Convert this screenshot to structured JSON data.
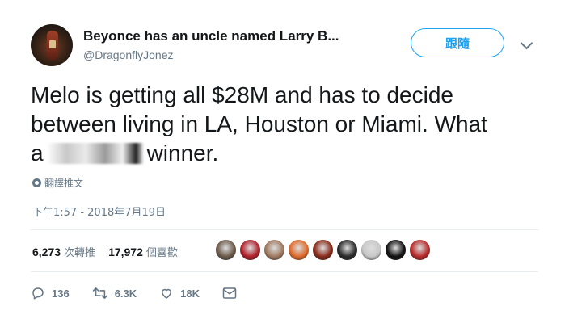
{
  "author": {
    "name": "Beyonce has an uncle named Larry B...",
    "handle": "@DragonflyJonez"
  },
  "follow_label": "跟隨",
  "tweet": {
    "line1": "Melo is getting all $28M and has to decide",
    "line2": "between living in LA, Houston or Miami. What",
    "line3_prefix": "a",
    "line3_suffix": "winner."
  },
  "translate_label": "翻譯推文",
  "timestamp": "下午1:57 - 2018年7月19日",
  "stats": {
    "retweets_count": "6,273",
    "retweets_label": "次轉推",
    "likes_count": "17,972",
    "likes_label": "個喜歡"
  },
  "liker_avatars": [
    {
      "name": "avatar-1",
      "color": "#6b5a4a"
    },
    {
      "name": "avatar-2",
      "color": "#b0202a"
    },
    {
      "name": "avatar-3",
      "color": "#a07a60"
    },
    {
      "name": "avatar-4",
      "color": "#e06a2a"
    },
    {
      "name": "avatar-5",
      "color": "#8a2a1a"
    },
    {
      "name": "avatar-6",
      "color": "#2a2a2a"
    },
    {
      "name": "avatar-7",
      "color": "#c8c8c8"
    },
    {
      "name": "avatar-8",
      "color": "#111111"
    },
    {
      "name": "avatar-9",
      "color": "#b82a2a"
    }
  ],
  "actions": {
    "reply_count": "136",
    "retweet_count": "6.3K",
    "like_count": "18K"
  },
  "colors": {
    "accent": "#1da1f2",
    "muted": "#657786",
    "text": "#14171a"
  }
}
